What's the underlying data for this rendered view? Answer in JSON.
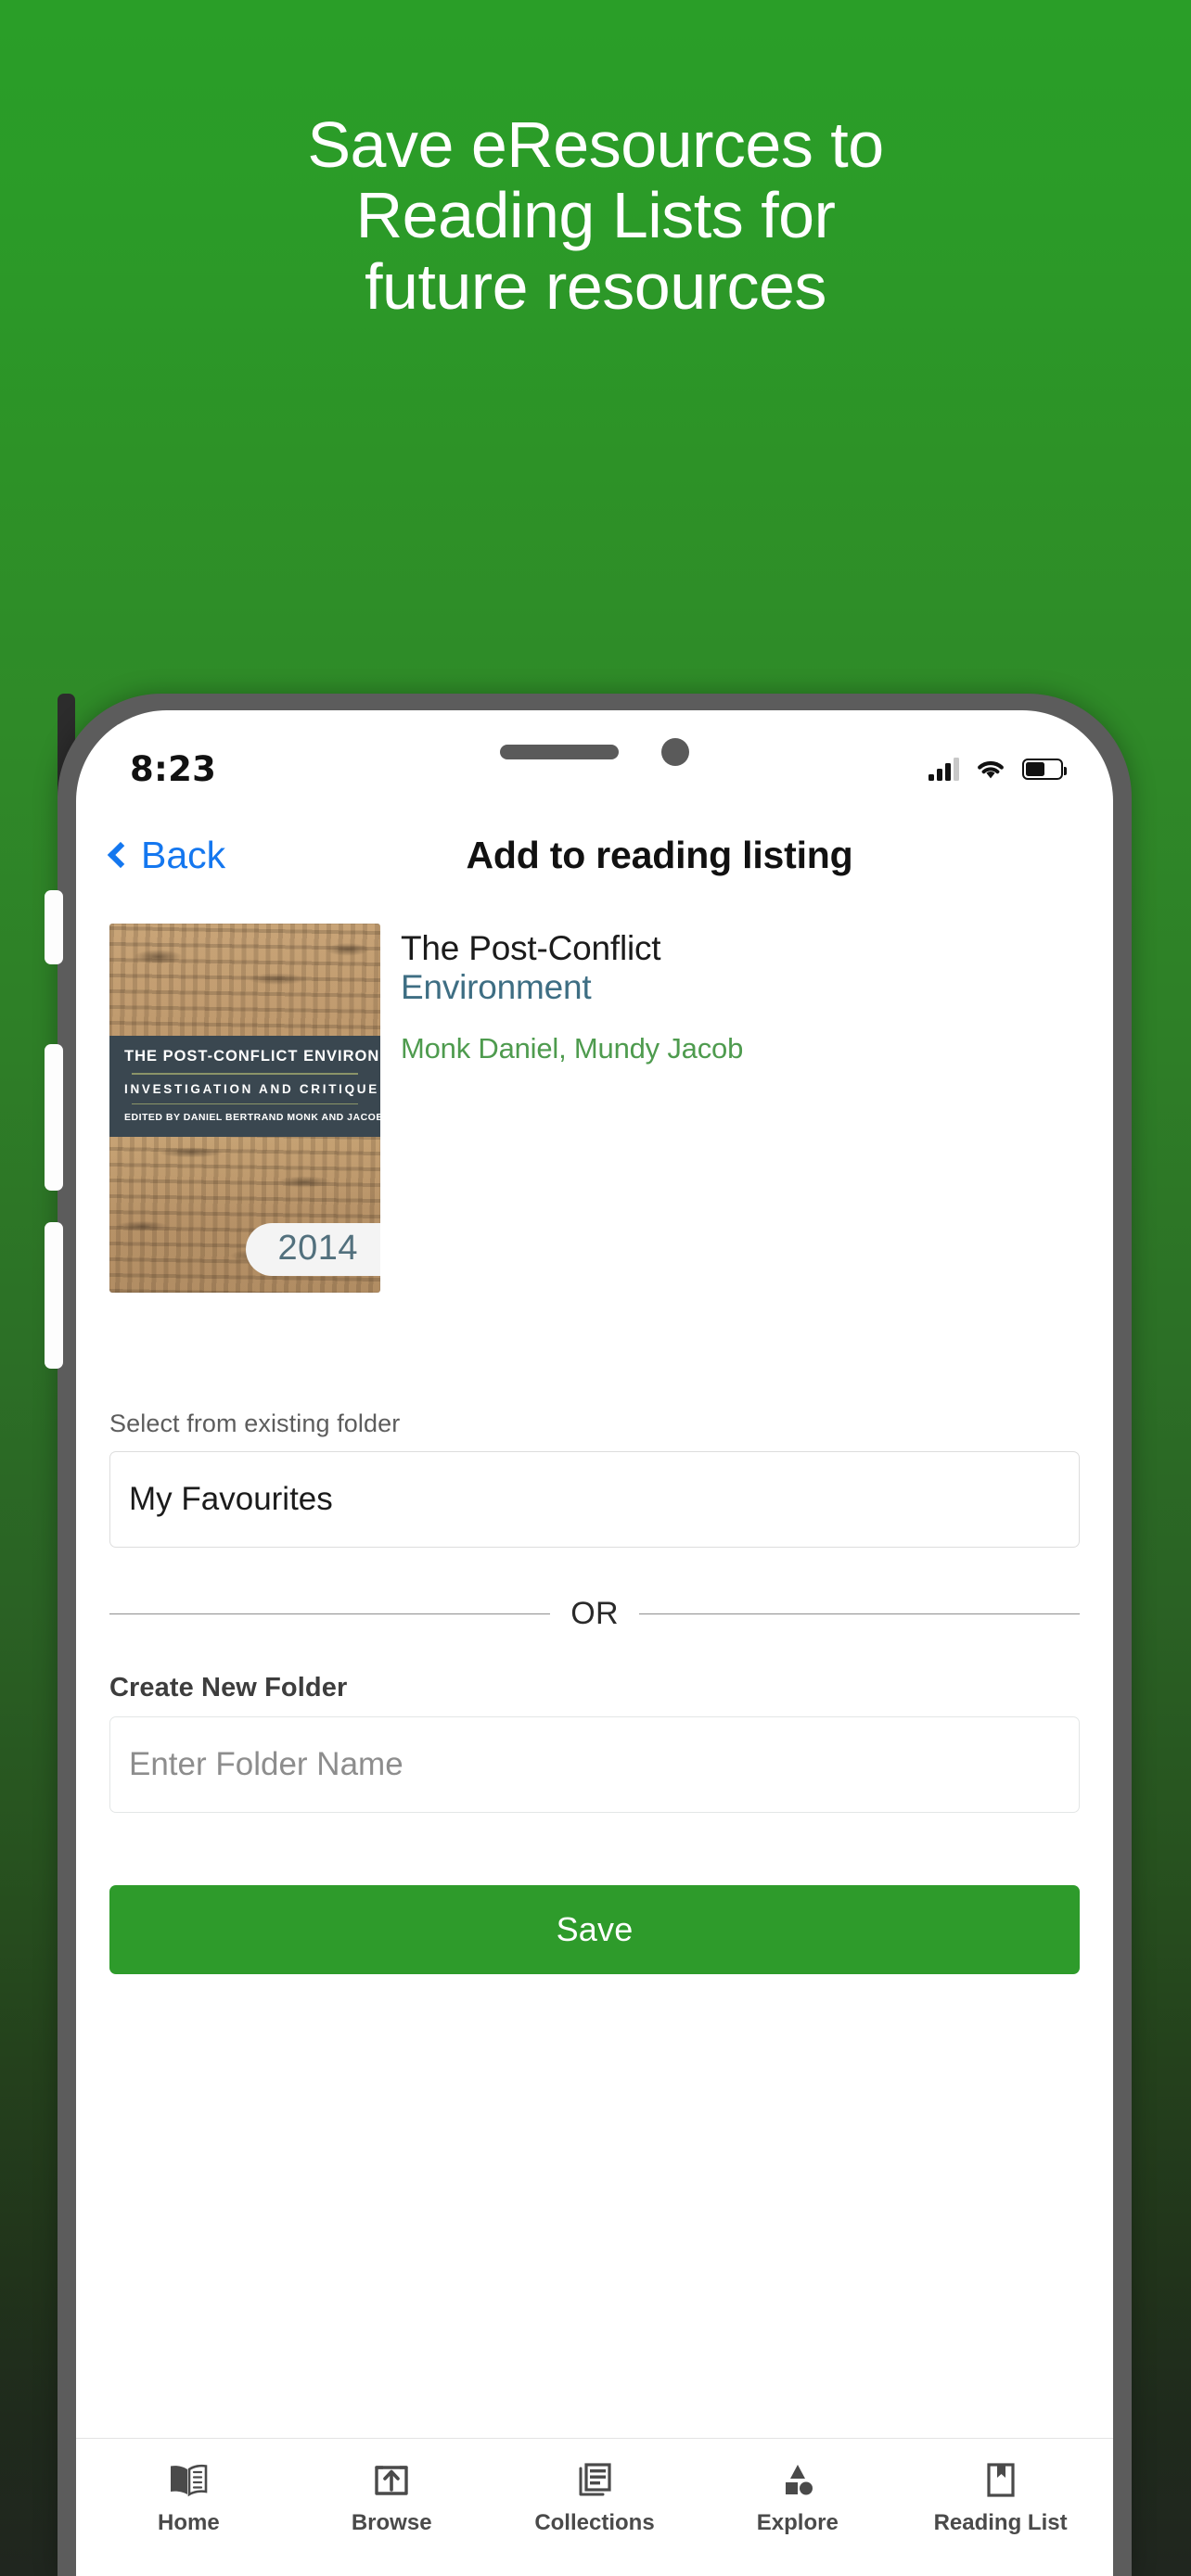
{
  "promo": {
    "headline_lines": [
      "Save eResources to",
      "Reading Lists for",
      "future resources"
    ],
    "background_top_color": "#2a9e28",
    "background_bottom_color": "#20261f"
  },
  "status_bar": {
    "time": "8:23",
    "signal_icon": "cellular-signal-icon",
    "wifi_icon": "wifi-icon",
    "battery_icon": "battery-icon"
  },
  "navbar": {
    "back_label": "Back",
    "back_icon": "chevron-left-icon",
    "title": "Add to reading listing",
    "back_color": "#1477ef"
  },
  "book": {
    "title": "The Post-Conflict",
    "subtitle": "Environment",
    "authors": "Monk Daniel,  Mundy Jacob",
    "year": "2014",
    "cover": {
      "band_title": "THE POST-CONFLICT ENVIRONMENT",
      "band_subtitle": "INVESTIGATION AND CRITIQUE",
      "band_editors": "EDITED BY DANIEL BERTRAND MONK AND JACOB MUNDY"
    }
  },
  "form": {
    "existing_folder_label": "Select from existing folder",
    "existing_folder_value": "My Favourites",
    "divider_label": "OR",
    "new_folder_label": "Create New Folder",
    "new_folder_placeholder": "Enter Folder Name",
    "save_label": "Save",
    "save_color": "#2e9b2b"
  },
  "tabbar": {
    "items": [
      {
        "label": "Home",
        "icon": "open-book-icon"
      },
      {
        "label": "Browse",
        "icon": "upload-box-icon"
      },
      {
        "label": "Collections",
        "icon": "stacked-documents-icon"
      },
      {
        "label": "Explore",
        "icon": "shapes-icon"
      },
      {
        "label": "Reading\nList",
        "icon": "bookmark-book-icon"
      }
    ]
  }
}
